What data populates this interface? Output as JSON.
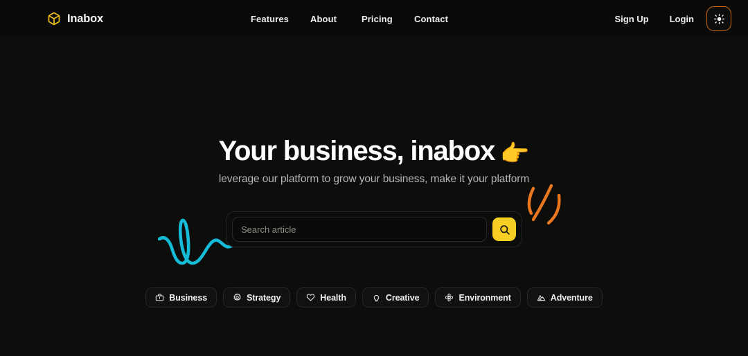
{
  "theme": {
    "page_bg": "#0b0b0b",
    "header_bg": "#0a0a09",
    "hero_bg": "#0d0d0c",
    "accent_yellow": "#f5cf23",
    "accent_orange": "#e8771f",
    "accent_cyan": "#14bcd8",
    "text_primary": "#ffffff",
    "text_muted": "#b6b6b6"
  },
  "header": {
    "brand": {
      "name": "Inabox",
      "icon": "box-cube-icon"
    },
    "nav": [
      {
        "label": "Features"
      },
      {
        "label": "About"
      },
      {
        "label": "Pricing"
      },
      {
        "label": "Contact"
      }
    ],
    "actions": {
      "signup_label": "Sign Up",
      "login_label": "Login",
      "theme_toggle_icon": "sun-icon"
    }
  },
  "hero": {
    "headline": "Your business, inabox",
    "headline_emoji": "👉",
    "subheadline": "leverage our platform to grow your business, make it your platform",
    "decorations": [
      {
        "name": "cyan-squiggle",
        "color": "#14bcd8"
      },
      {
        "name": "orange-strokes",
        "color": "#e8771f"
      }
    ],
    "search": {
      "placeholder": "Search article",
      "value": "",
      "button_icon": "search-icon"
    },
    "categories": [
      {
        "label": "Business",
        "icon": "briefcase-icon"
      },
      {
        "label": "Strategy",
        "icon": "gear-icon"
      },
      {
        "label": "Health",
        "icon": "heart-icon"
      },
      {
        "label": "Creative",
        "icon": "lightbulb-icon"
      },
      {
        "label": "Environment",
        "icon": "flower-icon"
      },
      {
        "label": "Adventure",
        "icon": "mountain-icon"
      }
    ]
  }
}
